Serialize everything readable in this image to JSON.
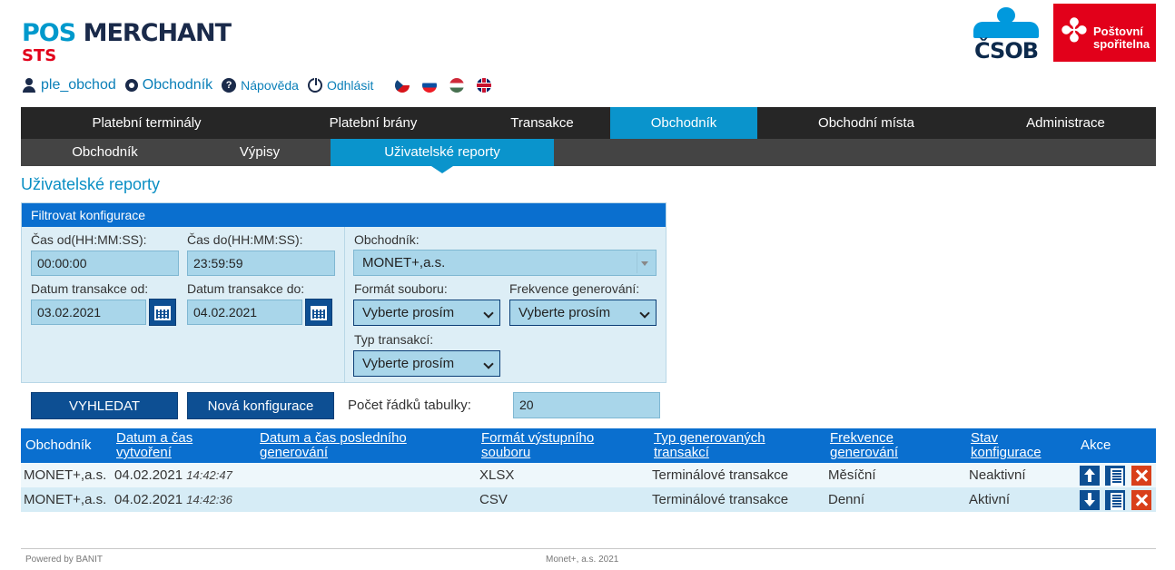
{
  "brand": {
    "title_pos": "POS",
    "title_merchant": "MERCHANT",
    "subtitle": "STS"
  },
  "userbar": {
    "username": "ple_obchod",
    "merchant_link": "Obchodník",
    "help_link": "Nápověda",
    "logout_link": "Odhlásit",
    "flags": [
      "cz-flag-icon",
      "sk-flag-icon",
      "hu-flag-icon",
      "gb-flag-icon"
    ]
  },
  "logos": {
    "csob": "ČSOB",
    "ps_line1": "Poštovní",
    "ps_line2": "spořitelna"
  },
  "nav": {
    "main": [
      "Platební terminály",
      "Platební brány",
      "Transakce",
      "Obchodník",
      "Obchodní místa",
      "Administrace"
    ],
    "main_active": "Obchodník",
    "sub": [
      "Obchodník",
      "Výpisy",
      "Uživatelské reporty"
    ],
    "sub_active": "Uživatelské reporty"
  },
  "page_title": "Uživatelské reporty",
  "filter": {
    "title": "Filtrovat konfigurace",
    "time_from_label": "Čas od(HH:MM:SS):",
    "time_from_value": "00:00:00",
    "time_to_label": "Čas do(HH:MM:SS):",
    "time_to_value": "23:59:59",
    "date_from_label": "Datum transakce od:",
    "date_from_value": "03.02.2021",
    "date_to_label": "Datum transakce do:",
    "date_to_value": "04.02.2021",
    "merchant_label": "Obchodník:",
    "merchant_value": "MONET+,a.s.",
    "format_label": "Formát souboru:",
    "format_value": "Vyberte prosím",
    "frequency_label": "Frekvence generování:",
    "frequency_value": "Vyberte prosím",
    "type_label": "Typ transakcí:",
    "type_value": "Vyberte prosím"
  },
  "actions": {
    "search_label": "VYHLEDAT",
    "new_config_label": "Nová konfigurace",
    "rows_label": "Počet řádků tabulky:",
    "rows_value": "20"
  },
  "table": {
    "headers": {
      "merchant": "Obchodník",
      "created_1": "Datum a čas",
      "created_2": "vytvoření",
      "last_gen_1": "Datum a čas posledního",
      "last_gen_2": "generování",
      "format_1": "Formát výstupního",
      "format_2": "souboru",
      "type_1": "Typ generovaných",
      "type_2": "transakcí",
      "freq_1": "Frekvence",
      "freq_2": "generování",
      "state_1": "Stav",
      "state_2": "konfigurace",
      "actions": "Akce"
    },
    "rows": [
      {
        "merchant": "MONET+,a.s.",
        "date": "04.02.2021",
        "time": "14:42:47",
        "last": "",
        "format": "XLSX",
        "type": "Terminálové transakce",
        "freq": "Měsíční",
        "state": "Neaktivní"
      },
      {
        "merchant": "MONET+,a.s.",
        "date": "04.02.2021",
        "time": "14:42:36",
        "last": "",
        "format": "CSV",
        "type": "Terminálové transakce",
        "freq": "Denní",
        "state": "Aktivní"
      }
    ]
  },
  "footer": {
    "left": "Powered by BANIT",
    "center": "Monet+, a.s. 2021"
  }
}
